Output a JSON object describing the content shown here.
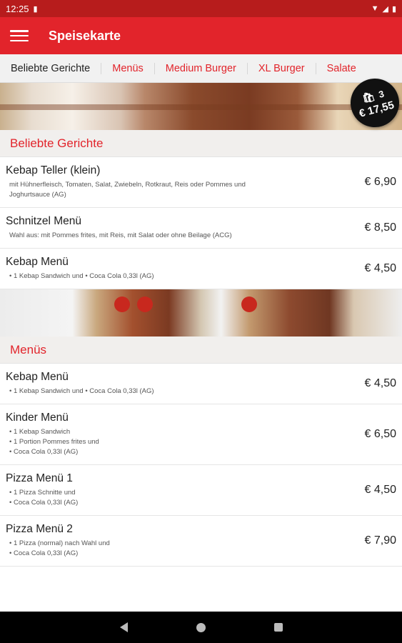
{
  "status": {
    "time": "12:25"
  },
  "appbar": {
    "title": "Speisekarte"
  },
  "tabs": [
    "Beliebte Gerichte",
    "Menüs",
    "Medium Burger",
    "XL Burger",
    "Salate"
  ],
  "cart": {
    "count": "3",
    "total": "€ 17,55"
  },
  "sections": [
    {
      "title": "Beliebte Gerichte",
      "items": [
        {
          "name": "Kebap Teller (klein)",
          "desc": [
            "mit Hühnerfleisch, Tomaten, Salat, Zwiebeln, Rotkraut, Reis oder Pommes und",
            "Joghurtsauce (AG)"
          ],
          "price": "€ 6,90"
        },
        {
          "name": "Schnitzel Menü",
          "desc": [
            "Wahl aus: mit Pommes frites, mit Reis, mit Salat oder ohne Beilage (ACG)"
          ],
          "price": "€ 8,50"
        },
        {
          "name": "Kebap Menü",
          "desc": [
            "• 1 Kebap Sandwich und   • Coca Cola 0,33l  (AG)"
          ],
          "price": "€ 4,50"
        }
      ]
    },
    {
      "title": "Menüs",
      "items": [
        {
          "name": "Kebap Menü",
          "desc": [
            "• 1 Kebap Sandwich und   • Coca Cola 0,33l  (AG)"
          ],
          "price": "€ 4,50"
        },
        {
          "name": "Kinder Menü",
          "desc": [
            "• 1 Kebap Sandwich",
            "• 1 Portion Pommes frites und",
            "• Coca Cola 0,33l  (AG)"
          ],
          "price": "€ 6,50"
        },
        {
          "name": "Pizza Menü 1",
          "desc": [
            "• 1 Pizza Schnitte und",
            "• Coca Cola 0,33l  (AG)"
          ],
          "price": "€ 4,50"
        },
        {
          "name": "Pizza Menü 2",
          "desc": [
            "• 1 Pizza (normal) nach Wahl und",
            "• Coca Cola 0,33l  (AG)"
          ],
          "price": "€ 7,90"
        }
      ]
    }
  ]
}
